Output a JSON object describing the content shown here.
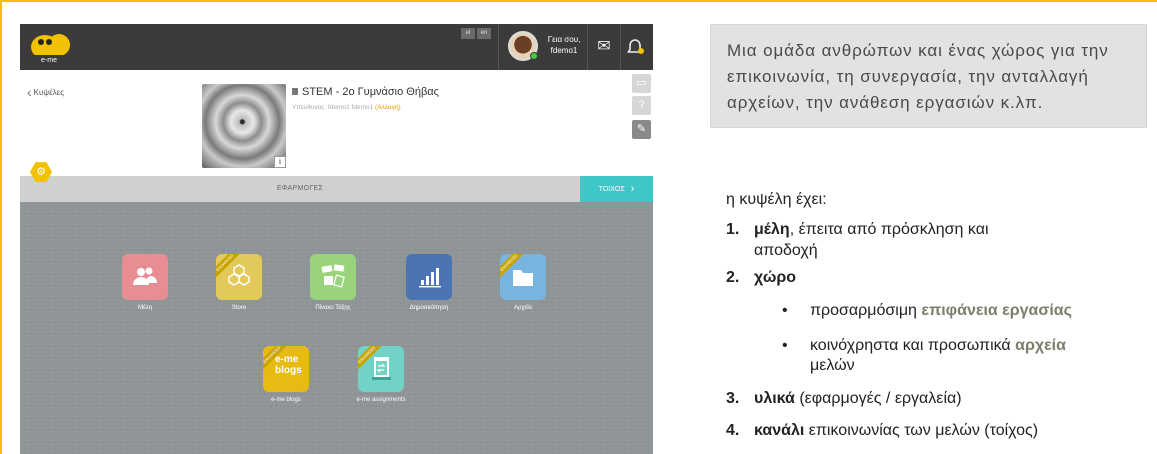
{
  "app": {
    "lang_options": [
      "el",
      "en"
    ],
    "user": {
      "greeting": "Γεια σου,",
      "name": "fdemo1"
    },
    "back_label": "Κυψέλες",
    "hive": {
      "title": "STEM - 2ο Γυμνάσιο Θήβας",
      "owner_prefix": "Υπεύθυνος: fdemo1 fdemo1",
      "owner_change": "(Αλλαγή)"
    },
    "apps_bar_label": "ΕΦΑΡΜΟΓΕΣ",
    "wall_button": "ΤΟΙΧΟΣ",
    "tiles": [
      {
        "label": "Μέλη",
        "color": "#e98d95",
        "icon": "members-icon",
        "ribbon": false
      },
      {
        "label": "Store",
        "color": "#e2c95a",
        "icon": "store-icon",
        "ribbon": true
      },
      {
        "label": "Πίνακο Τάξης",
        "color": "#9ad47a",
        "icon": "board-icon",
        "ribbon": false
      },
      {
        "label": "Δημοσκόπηση",
        "color": "#4b74b5",
        "icon": "poll-icon",
        "ribbon": false
      },
      {
        "label": "Αρχεία",
        "color": "#78b4e0",
        "icon": "folder-icon",
        "ribbon": true
      },
      {
        "label": "e-me blogs",
        "color": "#e8bb12",
        "icon": "blogs-icon",
        "ribbon": true,
        "tile_text": "e-me blogs"
      },
      {
        "label": "e-me assignments",
        "color": "#72d2c6",
        "icon": "assignments-icon",
        "ribbon": true
      }
    ],
    "ribbon_text": "ENHANCED"
  },
  "panel": {
    "callout": "Μια ομάδα ανθρώπων και ένας χώρος για την επικοινωνία, τη συνεργασία, την ανταλλαγή αρχείων, την ανάθεση εργασιών κ.λπ.",
    "intro": "η κυψέλη έχει:",
    "items": [
      {
        "num": "1.",
        "bold": "μέλη",
        "rest": ", έπειτα από πρόσκληση και",
        "cont": "αποδοχή"
      },
      {
        "num": "2.",
        "bold": "χώρο",
        "rest": ""
      },
      {
        "num": "3.",
        "bold": "υλικά",
        "rest": " (εφαρμογές / εργαλεία)"
      },
      {
        "num": "4.",
        "bold": "κανάλι",
        "rest": " επικοινωνίας των μελών (τοίχος)"
      }
    ],
    "sub_items": [
      {
        "pre": "προσαρμόσιμη ",
        "hl": "επιφάνεια εργασίας",
        "post": ""
      },
      {
        "pre": "κοινόχρηστα και προσωπικά ",
        "hl": "αρχεία",
        "post": "",
        "cont": "μελών"
      }
    ]
  }
}
